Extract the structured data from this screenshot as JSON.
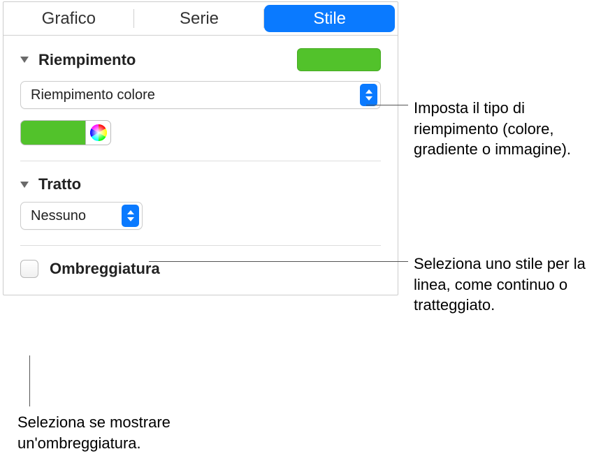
{
  "tabs": {
    "grafico": "Grafico",
    "serie": "Serie",
    "stile": "Stile"
  },
  "fill": {
    "section_label": "Riempimento",
    "swatch_color": "#52c22b",
    "popup_value": "Riempimento colore"
  },
  "stroke": {
    "section_label": "Tratto",
    "popup_value": "Nessuno"
  },
  "shadow": {
    "label": "Ombreggiatura"
  },
  "annotations": {
    "fill_type": "Imposta il tipo di riempimento (colore, gradiente o immagine).",
    "line_style": "Seleziona uno stile per la linea, come continuo o tratteggiato.",
    "show_shadow": "Seleziona se mostrare un'ombreggiatura."
  }
}
